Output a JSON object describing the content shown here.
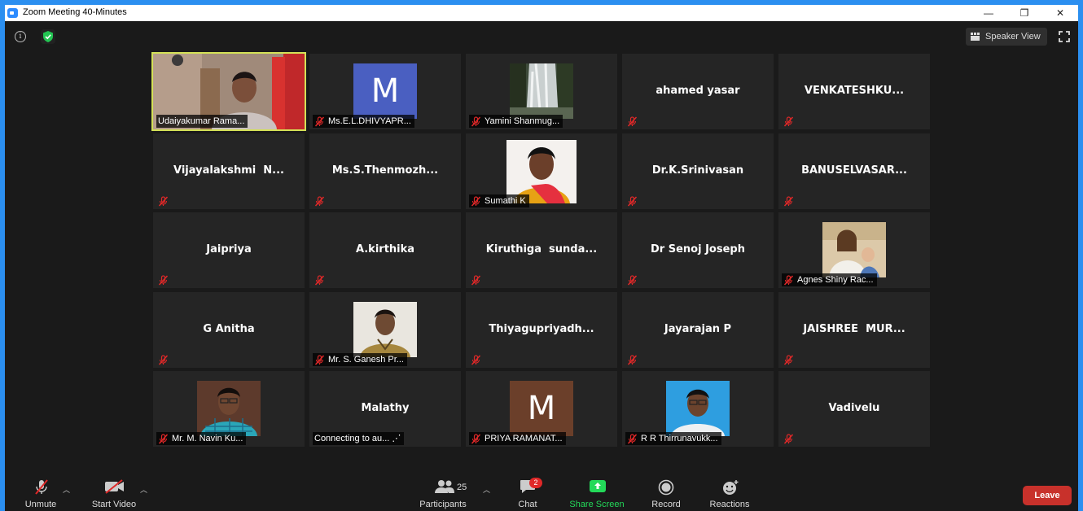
{
  "window": {
    "title": "Zoom Meeting 40-Minutes",
    "minimize": "—",
    "restore": "❐",
    "close": "✕"
  },
  "topbar": {
    "speaker_view_label": "Speaker View"
  },
  "tiles": [
    {
      "name": "Udaiyakumar Rama...",
      "type": "photo",
      "active": true,
      "muted": false
    },
    {
      "name": "Ms.E.L.DHIVYAPR...",
      "type": "letter",
      "letter": "M",
      "letter_color": "#4a5fc1",
      "muted": true
    },
    {
      "name": "Yamini Shanmug...",
      "type": "waterfall",
      "muted": true
    },
    {
      "name": "ahamed yasar",
      "type": "text",
      "muted": true
    },
    {
      "name": "VENKATESHKU...",
      "type": "text",
      "muted": true
    },
    {
      "name": "Vijayalakshmi  N...",
      "type": "text",
      "muted": true
    },
    {
      "name": "Ms.S.Thenmozh...",
      "type": "text",
      "muted": true
    },
    {
      "name": "Sumathi K",
      "type": "woman",
      "muted": true
    },
    {
      "name": "Dr.K.Srinivasan",
      "type": "text",
      "muted": true
    },
    {
      "name": "BANUSELVASAR...",
      "type": "text",
      "muted": true
    },
    {
      "name": "Jaipriya",
      "type": "text",
      "muted": true
    },
    {
      "name": "A.kirthika",
      "type": "text",
      "muted": true
    },
    {
      "name": "Kiruthiga  sunda...",
      "type": "text",
      "muted": true
    },
    {
      "name": "Dr Senoj Joseph",
      "type": "text",
      "muted": true
    },
    {
      "name": "Agnes Shiny Rac...",
      "type": "painting",
      "muted": true
    },
    {
      "name": "G Anitha",
      "type": "text",
      "muted": true
    },
    {
      "name": "Mr. S. Ganesh Pr...",
      "type": "man_outdoor",
      "muted": true
    },
    {
      "name": "Thiyagupriyadh...",
      "type": "text",
      "muted": true
    },
    {
      "name": "Jayarajan P",
      "type": "text",
      "muted": true
    },
    {
      "name": "JAISHREE  MUR...",
      "type": "text",
      "muted": true
    },
    {
      "name": "Mr. M. Navin Ku...",
      "type": "man_shirt",
      "muted": true
    },
    {
      "name": "Malathy",
      "type": "text",
      "muted": false,
      "status": "Connecting to au... ⋰"
    },
    {
      "name": "PRIYA RAMANAT...",
      "type": "letter",
      "letter": "M",
      "letter_color": "#6b3f2a",
      "muted": true
    },
    {
      "name": "R R Thirrunavukk...",
      "type": "man_blue",
      "muted": true
    },
    {
      "name": "Vadivelu",
      "type": "text",
      "muted": true
    }
  ],
  "toolbar": {
    "unmute": "Unmute",
    "start_video": "Start Video",
    "participants": "Participants",
    "participants_count": "25",
    "chat": "Chat",
    "chat_badge": "2",
    "share_screen": "Share Screen",
    "record": "Record",
    "reactions": "Reactions",
    "leave": "Leave"
  },
  "colors": {
    "share_green": "#23d959",
    "active_outline": "#d4e157",
    "leave_red": "#c8312b",
    "mute_red": "#e02828"
  }
}
